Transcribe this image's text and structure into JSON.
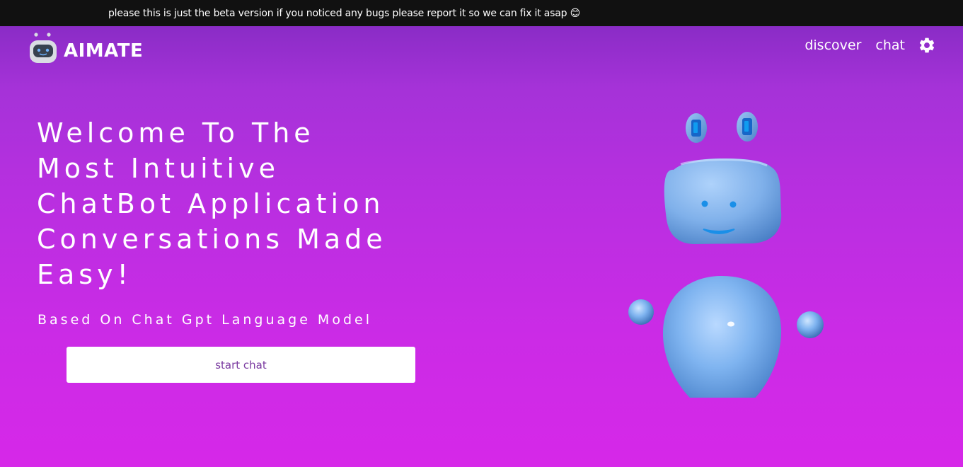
{
  "banner": {
    "text": "please this is just the beta version if you noticed any bugs please report it so we can fix it asap 😊"
  },
  "header": {
    "brand": "AIMATE",
    "logo_icon": "robot-icon",
    "nav": {
      "discover": "discover",
      "chat": "chat",
      "settings_icon": "gear-icon"
    }
  },
  "hero": {
    "headline_lines": [
      "Welcome To The",
      "Most Intuitive",
      "ChatBot Application",
      "Conversations Made",
      "Easy!"
    ],
    "subheadline": "Based On Chat Gpt Language Model",
    "cta_label": "start chat",
    "illustration_icon": "3d-robot-illustration"
  },
  "colors": {
    "banner_bg": "#111111",
    "gradient_top": "#8a2cc6",
    "gradient_bottom": "#d628e8",
    "cta_text": "#7a3aa0",
    "robot_body": "#7fb4f0"
  }
}
